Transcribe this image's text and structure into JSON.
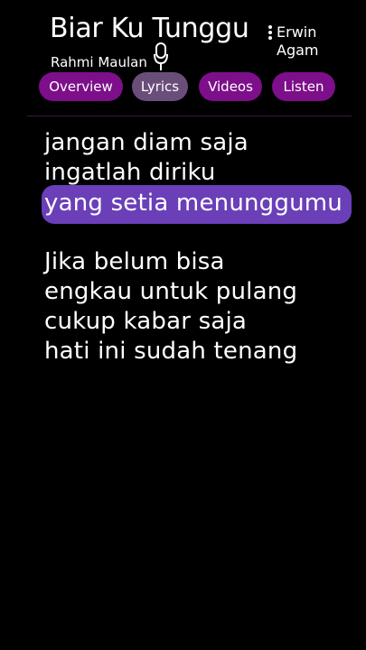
{
  "song": {
    "title": "Biar Ku Tunggu",
    "artist_primary": "Rahmi Maulan",
    "artist_secondary": "Erwin Agam"
  },
  "tabs": [
    {
      "label": "Overview"
    },
    {
      "label": "Lyrics"
    },
    {
      "label": "Videos"
    },
    {
      "label": "Listen"
    }
  ],
  "lyrics": {
    "lines": [
      "jangan diam saja",
      "ingatlah diriku",
      "yang setia menunggumu",
      "Jika belum bisa",
      "engkau untuk pulang",
      "cukup kabar saja",
      "hati ini sudah tenang"
    ],
    "active_index": 2
  },
  "colors": {
    "tab_bg": "#7d0f8a",
    "tab_active_bg": "#6a4e7a",
    "highlight": "#6a3fb8"
  },
  "icons": [
    "more-vertical-icon",
    "microphone-icon"
  ]
}
